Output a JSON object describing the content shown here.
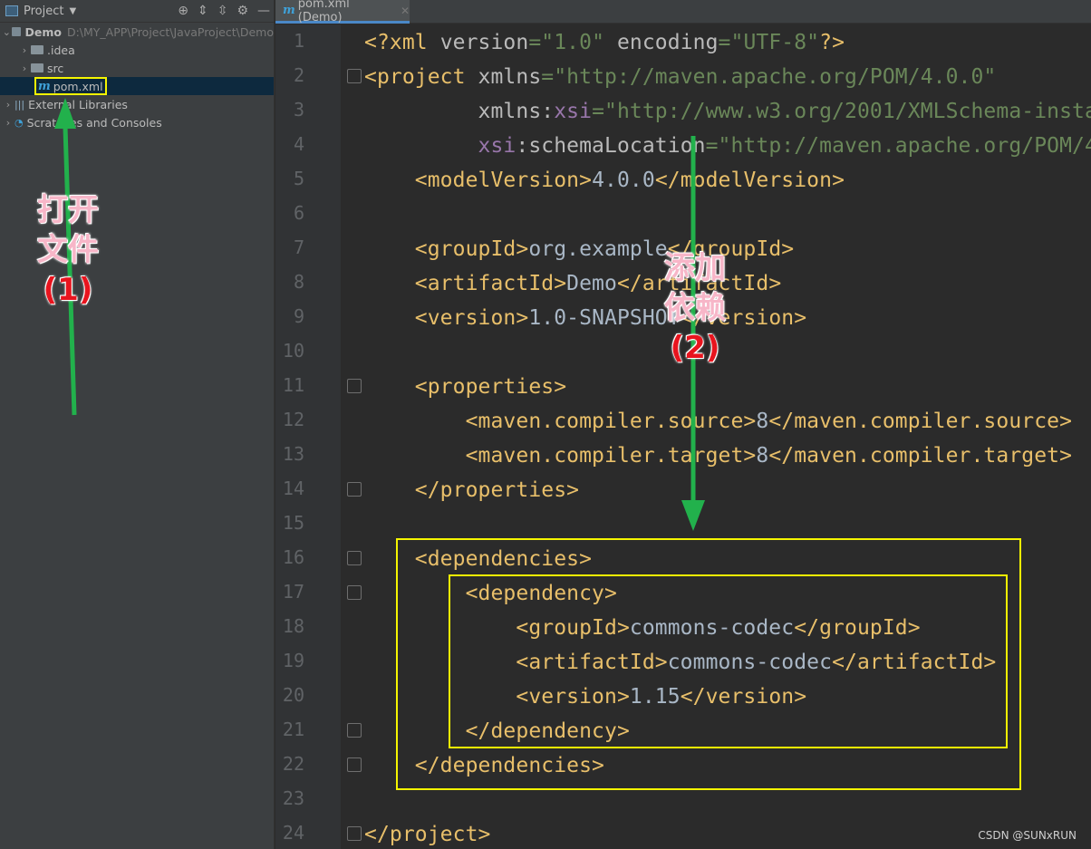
{
  "sidebar": {
    "title": "Project",
    "items": [
      {
        "label": "Demo",
        "path": "D:\\MY_APP\\Project\\JavaProject\\Demo"
      },
      {
        "label": ".idea"
      },
      {
        "label": "src"
      },
      {
        "label": "pom.xml"
      },
      {
        "label": "External Libraries"
      },
      {
        "label": "Scratches and Consoles"
      }
    ]
  },
  "editor": {
    "tab_label": "pom.xml (Demo)",
    "lines": [
      [
        [
          "t",
          "<?xml "
        ],
        [
          "a",
          "version"
        ],
        [
          "s",
          "=\"1.0\" "
        ],
        [
          "a",
          "encoding"
        ],
        [
          "s",
          "=\"UTF-8\""
        ],
        [
          "t",
          "?>"
        ]
      ],
      [
        [
          "t",
          "<project "
        ],
        [
          "a",
          "xmlns"
        ],
        [
          "s",
          "=\"http://maven.apache.org/POM/4.0.0\""
        ]
      ],
      [
        [
          "x",
          "         "
        ],
        [
          "a",
          "xmlns:"
        ],
        [
          "p",
          "xsi"
        ],
        [
          "s",
          "=\"http://www.w3.org/2001/XMLSchema-insta"
        ]
      ],
      [
        [
          "x",
          "         "
        ],
        [
          "p",
          "xsi"
        ],
        [
          "a",
          ":schemaLocation"
        ],
        [
          "s",
          "=\"http://maven.apache.org/POM/4"
        ]
      ],
      [
        [
          "t",
          "    <modelVersion>"
        ],
        [
          "x",
          "4.0.0"
        ],
        [
          "t",
          "</modelVersion>"
        ]
      ],
      [],
      [
        [
          "t",
          "    <groupId>"
        ],
        [
          "x",
          "org.example"
        ],
        [
          "t",
          "</groupId>"
        ]
      ],
      [
        [
          "t",
          "    <artifactId>"
        ],
        [
          "x",
          "Demo"
        ],
        [
          "t",
          "</artifactId>"
        ]
      ],
      [
        [
          "t",
          "    <version>"
        ],
        [
          "x",
          "1.0-SNAPSHOT"
        ],
        [
          "t",
          "</version>"
        ]
      ],
      [],
      [
        [
          "t",
          "    <properties>"
        ]
      ],
      [
        [
          "t",
          "        <maven.compiler.source>"
        ],
        [
          "x",
          "8"
        ],
        [
          "t",
          "</maven.compiler.source>"
        ]
      ],
      [
        [
          "t",
          "        <maven.compiler.target>"
        ],
        [
          "x",
          "8"
        ],
        [
          "t",
          "</maven.compiler.target>"
        ]
      ],
      [
        [
          "t",
          "    </properties>"
        ]
      ],
      [],
      [
        [
          "t",
          "    <dependencies>"
        ]
      ],
      [
        [
          "t",
          "        <dependency>"
        ]
      ],
      [
        [
          "t",
          "            <groupId>"
        ],
        [
          "x",
          "commons-codec"
        ],
        [
          "t",
          "</groupId>"
        ]
      ],
      [
        [
          "t",
          "            <artifactId>"
        ],
        [
          "x",
          "commons-codec"
        ],
        [
          "t",
          "</artifactId>"
        ]
      ],
      [
        [
          "t",
          "            <version>"
        ],
        [
          "x",
          "1.15"
        ],
        [
          "t",
          "</version>"
        ]
      ],
      [
        [
          "t",
          "        </dependency>"
        ]
      ],
      [
        [
          "t",
          "    </dependencies>"
        ]
      ],
      [],
      [
        [
          "t",
          "</project>"
        ]
      ]
    ]
  },
  "annotations": {
    "step1_text1": "打开",
    "step1_text2": "文件",
    "step1_num": "(1)",
    "step2_text1": "添加",
    "step2_text2": "依赖",
    "step2_num": "(2)",
    "arrow_color": "#22b14c",
    "box_color": "#f5f500"
  },
  "watermark": "CSDN @SUNxRUN"
}
